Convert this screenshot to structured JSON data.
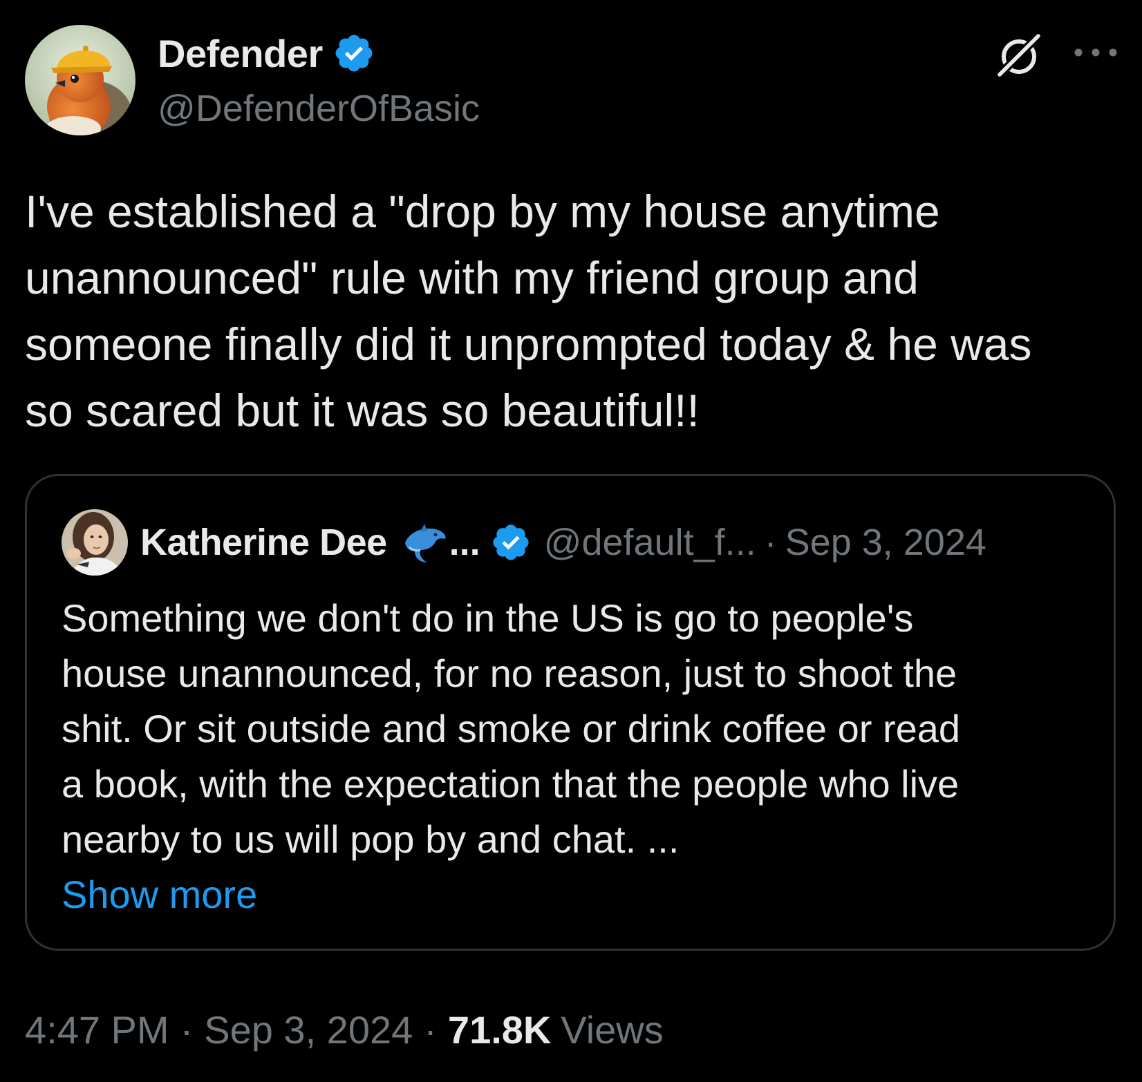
{
  "tweet": {
    "author": {
      "name": "Defender",
      "handle": "@DefenderOfBasic",
      "verified": true,
      "avatar_icon": "robin-with-yellow-cap-avatar"
    },
    "text": "I've established a \"drop by my house anytime\nunannounced\" rule with my friend group and\nsomeone finally did it unprompted today & he was\nso scared but it was so beautiful!!",
    "actions": {
      "grok_icon": "grok-icon",
      "more_icon": "more-options-icon"
    },
    "quoted": {
      "author_name": "Katherine Dee",
      "name_emoji": "dolphin-icon",
      "name_ellipsis": "...",
      "handle": "@default_f...",
      "separator": "·",
      "date": "Sep 3, 2024",
      "verified": true,
      "text": "Something we don't do in the US is go to people's\nhouse unannounced, for no reason, just to shoot the\nshit. Or sit outside and smoke or drink coffee or read\na book, with the expectation that the people who live\nnearby to us will pop by and chat. ...",
      "show_more": "Show more"
    },
    "meta": {
      "time": "4:47 PM",
      "sep1": "·",
      "date": "Sep 3, 2024",
      "sep2": "·",
      "views_count": "71.8K",
      "views_label": "Views"
    }
  },
  "colors": {
    "background": "#000000",
    "text_primary": "#e7e9ea",
    "text_secondary": "#71767b",
    "accent_blue": "#1d9bf0",
    "border": "#2f3336"
  }
}
